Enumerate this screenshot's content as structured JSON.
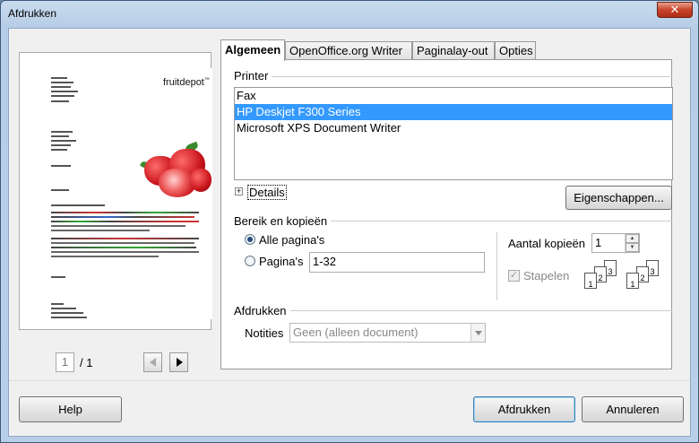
{
  "window": {
    "title": "Afdrukken",
    "close_glyph": "✕"
  },
  "preview": {
    "logo": "fruitdepot",
    "logo_mark": "™",
    "page_current": "1",
    "page_total": "/ 1"
  },
  "tabs": [
    {
      "label": "Algemeen",
      "active": true
    },
    {
      "label": "OpenOffice.org Writer",
      "active": false
    },
    {
      "label": "Paginalay-out",
      "active": false
    },
    {
      "label": "Opties",
      "active": false
    }
  ],
  "printer": {
    "section_label": "Printer",
    "items": [
      "Fax",
      "HP Deskjet F300 Series",
      "Microsoft XPS Document Writer"
    ],
    "selected_index": 1,
    "details_label": "Details",
    "properties_button": "Eigenschappen..."
  },
  "range": {
    "section_label": "Bereik en kopieën",
    "all_pages": "Alle pagina's",
    "pages": "Pagina's",
    "pages_value": "1-32",
    "copies_label": "Aantal kopieën",
    "copies_value": "1",
    "collate_label": "Stapelen",
    "selected": "all_pages"
  },
  "print": {
    "section_label": "Afdrukken",
    "notes_label": "Notities",
    "notes_value": "Geen (alleen document)"
  },
  "buttons": {
    "help": "Help",
    "print": "Afdrukken",
    "cancel": "Annuleren"
  }
}
